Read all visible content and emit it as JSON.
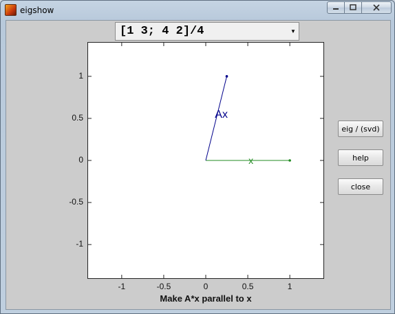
{
  "window": {
    "title": "eigshow"
  },
  "controls": {
    "matrix_expression": "[1 3; 4 2]/4",
    "buttons": [
      "eig / (svd)",
      "help",
      "close"
    ]
  },
  "plot": {
    "xlabel": "Make A*x parallel to x",
    "x_ticks": [
      "-1",
      "-0.5",
      "0",
      "0.5",
      "1"
    ],
    "y_ticks": [
      "1",
      "0.5",
      "0",
      "-0.5",
      "-1"
    ],
    "vectors": [
      {
        "label": "x",
        "from": [
          0,
          0
        ],
        "to": [
          1,
          0
        ],
        "color": "#228b22"
      },
      {
        "label": "Ax",
        "from": [
          0,
          0
        ],
        "to": [
          0.25,
          1
        ],
        "color": "#00008b"
      }
    ],
    "xlim": [
      -1.4,
      1.4
    ],
    "ylim": [
      -1.4,
      1.4
    ]
  }
}
